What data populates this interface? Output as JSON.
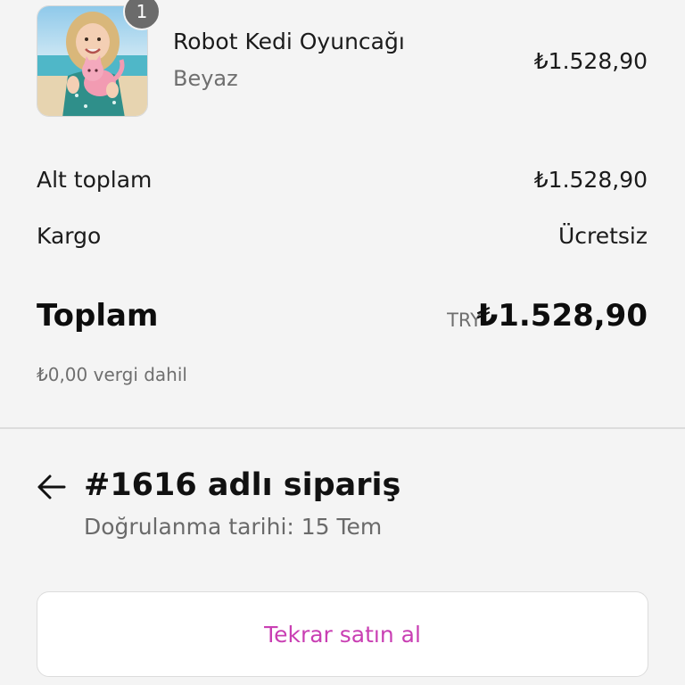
{
  "product": {
    "quantity": "1",
    "name": "Robot Kedi Oyuncağı",
    "variant": "Beyaz",
    "price": "₺1.528,90"
  },
  "summary": {
    "subtotal_label": "Alt toplam",
    "subtotal_value": "₺1.528,90",
    "shipping_label": "Kargo",
    "shipping_value": "Ücretsiz",
    "total_label": "Toplam",
    "total_currency": "TRY",
    "total_value": "₺1.528,90",
    "tax_note": "₺0,00 vergi dahil"
  },
  "order": {
    "title": "#1616 adlı sipariş",
    "confirmed_date": "Doğrulanma tarihi: 15 Tem",
    "back_icon": "arrow-left-icon"
  },
  "actions": {
    "rebuy_label": "Tekrar satın al"
  },
  "colors": {
    "background": "#f4f4f4",
    "accent": "#c93fb3",
    "muted_text": "#6f6f6f",
    "badge": "#6b6b6b"
  }
}
